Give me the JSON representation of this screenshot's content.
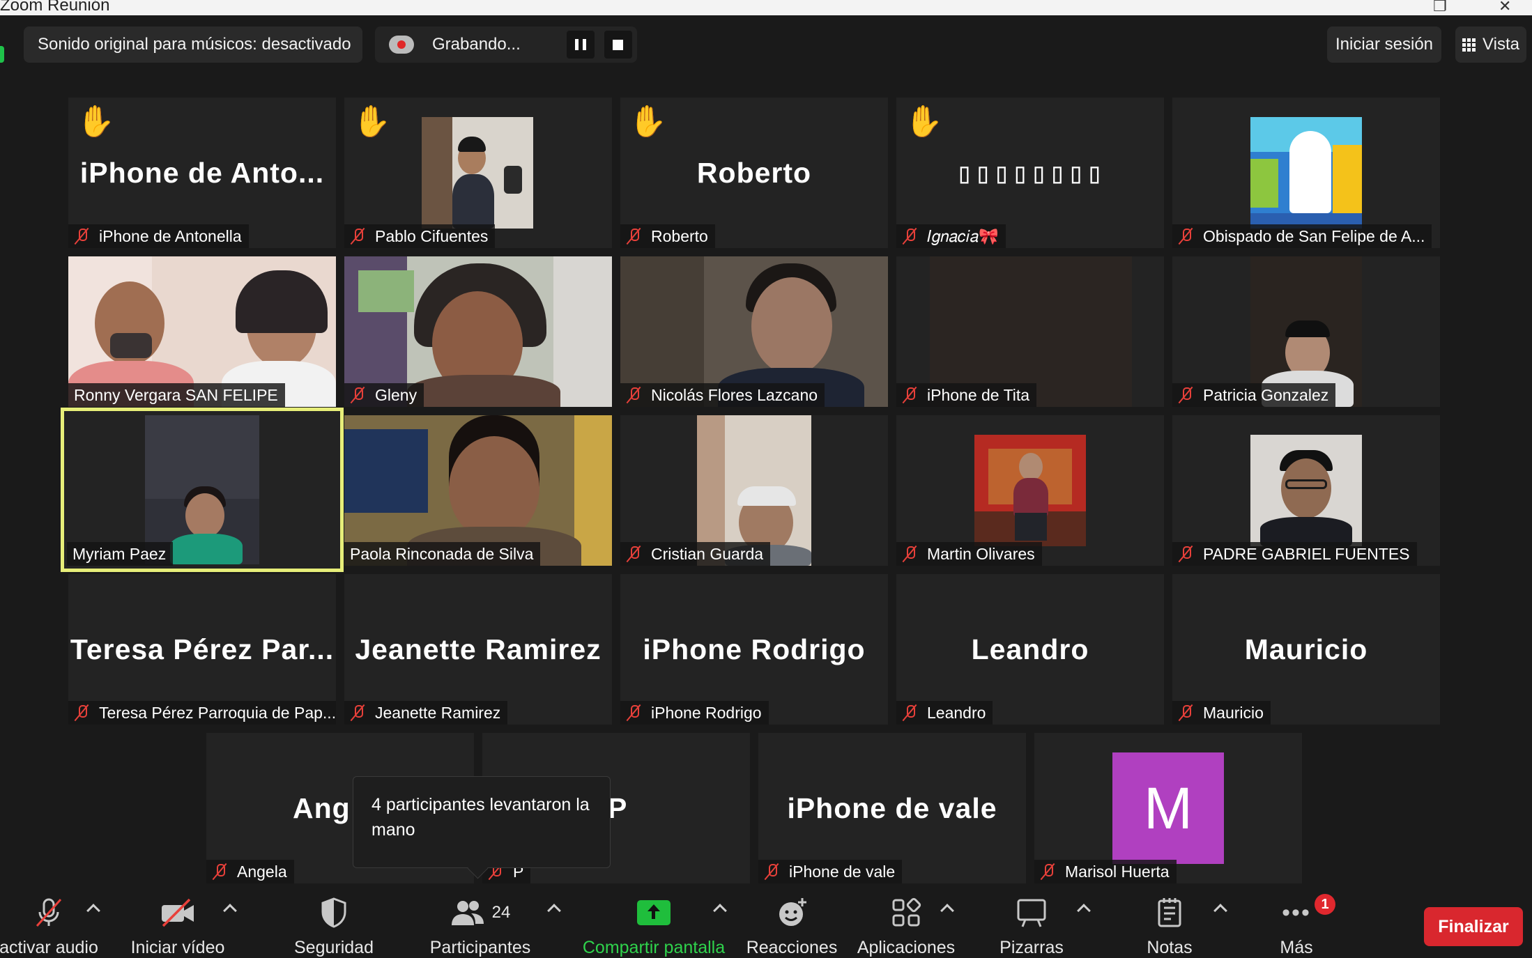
{
  "window": {
    "title": "Zoom Reunión"
  },
  "topbar": {
    "original_sound": "Sonido original para músicos: desactivado",
    "recording": "Grabando...",
    "sign_in": "Iniciar sesión",
    "view": "Vista"
  },
  "tiles": [
    {
      "big": "iPhone de Anto...",
      "label": "iPhone de Antonella",
      "hand": true,
      "muted": true
    },
    {
      "big": "",
      "label": "Pablo Cifuentes",
      "hand": true,
      "muted": true
    },
    {
      "big": "Roberto",
      "label": "Roberto",
      "hand": true,
      "muted": true
    },
    {
      "big": "▯▯▯▯▯▯▯▯",
      "label": "𝐼𝑔𝑛𝑎𝑐𝑖𝑎🎀",
      "hand": true,
      "muted": true
    },
    {
      "big": "",
      "label": "Obispado de San Felipe de A...",
      "hand": false,
      "muted": true
    },
    {
      "big": "",
      "label": "Ronny Vergara SAN FELIPE",
      "muted": false
    },
    {
      "big": "",
      "label": "Gleny",
      "muted": true
    },
    {
      "big": "",
      "label": "Nicolás Flores Lazcano",
      "muted": true
    },
    {
      "big": "",
      "label": "iPhone de Tita",
      "muted": true
    },
    {
      "big": "",
      "label": "Patricia Gonzalez",
      "muted": true
    },
    {
      "big": "",
      "label": "Myriam Paez",
      "muted": false
    },
    {
      "big": "",
      "label": "Paola Rinconada de Silva",
      "muted": false
    },
    {
      "big": "",
      "label": "Cristian Guarda",
      "muted": true
    },
    {
      "big": "",
      "label": "Martin Olivares",
      "muted": true
    },
    {
      "big": "",
      "label": "PADRE GABRIEL FUENTES",
      "muted": true
    },
    {
      "big": "Teresa  Pérez  Par...",
      "label": "Teresa Pérez Parroquia de Pap...",
      "muted": true
    },
    {
      "big": "Jeanette Ramirez",
      "label": "Jeanette Ramirez",
      "muted": true
    },
    {
      "big": "iPhone Rodrigo",
      "label": "iPhone Rodrigo",
      "muted": true
    },
    {
      "big": "Leandro",
      "label": "Leandro",
      "muted": true
    },
    {
      "big": "Mauricio",
      "label": "Mauricio",
      "muted": true
    },
    {
      "big": "Ang",
      "label": "Angela",
      "muted": true
    },
    {
      "big": "P",
      "label": "P",
      "muted": true
    },
    {
      "big": "iPhone de vale",
      "label": "iPhone de vale",
      "muted": true
    },
    {
      "big": "",
      "label": "Marisol Huerta",
      "avatar_letter": "M",
      "avatar_color": "#b040c0",
      "muted": true
    }
  ],
  "tooltip": {
    "text": "4 participantes levantaron la mano"
  },
  "toolbar": {
    "audio": "activar audio",
    "video": "Iniciar vídeo",
    "security": "Seguridad",
    "participants": "Participantes",
    "participants_count": "24",
    "share": "Compartir pantalla",
    "reactions": "Reacciones",
    "apps": "Aplicaciones",
    "whiteboards": "Pizarras",
    "notes": "Notas",
    "more": "Más",
    "more_badge": "1",
    "end": "Finalizar"
  },
  "colors": {
    "background": "#1a1a1a",
    "tile": "#232323",
    "active_speaker": "#e7ee79",
    "muted_icon": "#e8403a",
    "share_green": "#1fbe3c",
    "end_red": "#d9272e"
  }
}
